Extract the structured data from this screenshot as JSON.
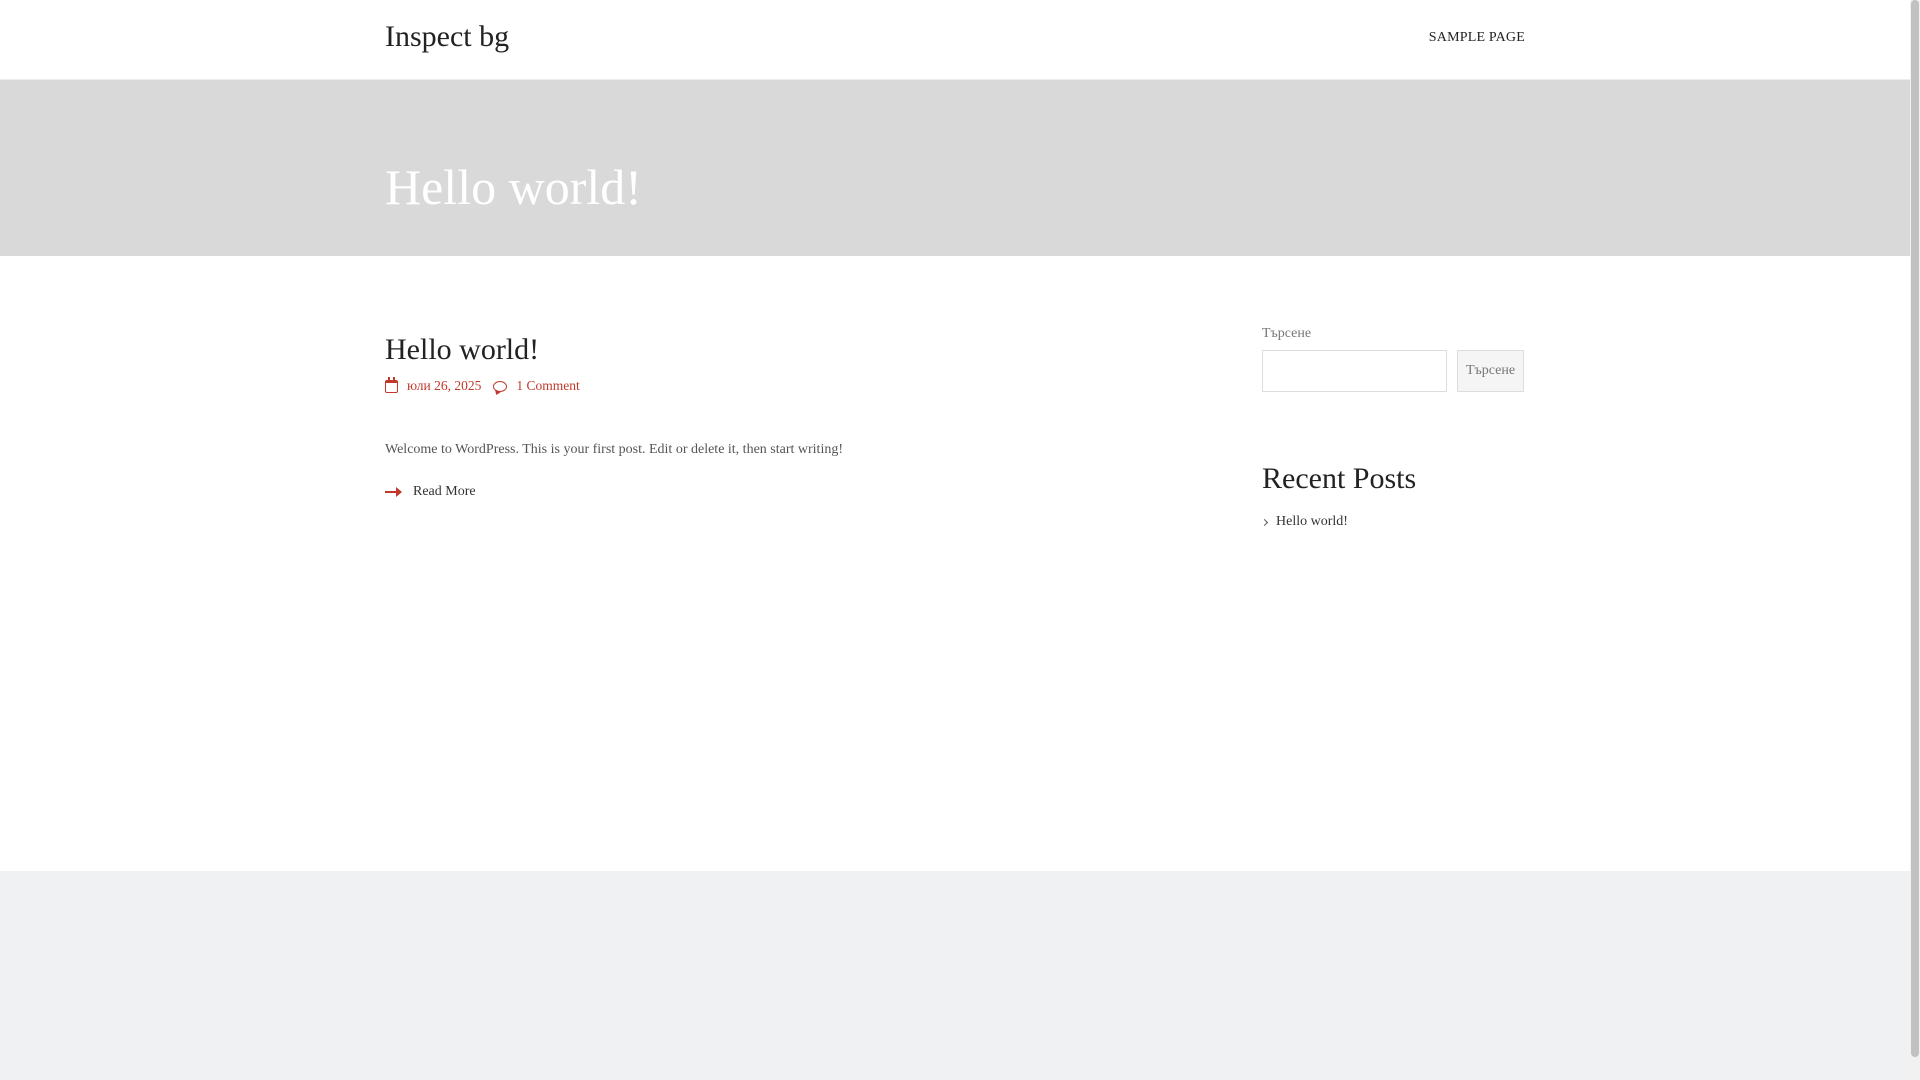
{
  "header": {
    "site_title": "Inspect bg",
    "nav": [
      {
        "label": "SAMPLE PAGE"
      }
    ]
  },
  "hero": {
    "title": "Hello world!"
  },
  "post": {
    "title": "Hello world!",
    "date": "юли 26, 2025",
    "comments": "1 Comment",
    "excerpt": "Welcome to WordPress. This is your first post. Edit or delete it, then start writing!",
    "read_more": "Read More"
  },
  "sidebar": {
    "search": {
      "label": "Търсене",
      "value": "",
      "button_label": "Търсене"
    },
    "recent_posts": {
      "title": "Recent Posts",
      "items": [
        {
          "label": "Hello world!"
        }
      ]
    }
  },
  "colors": {
    "accent": "#c0392b",
    "hero_bg": "#d9d9d9",
    "footer_bg": "#f0f1f3"
  },
  "icons": {
    "date": "calendar-icon",
    "comments": "comment-icon",
    "read_more": "arrow-right-icon",
    "recent_post": "chevron-right-icon"
  }
}
